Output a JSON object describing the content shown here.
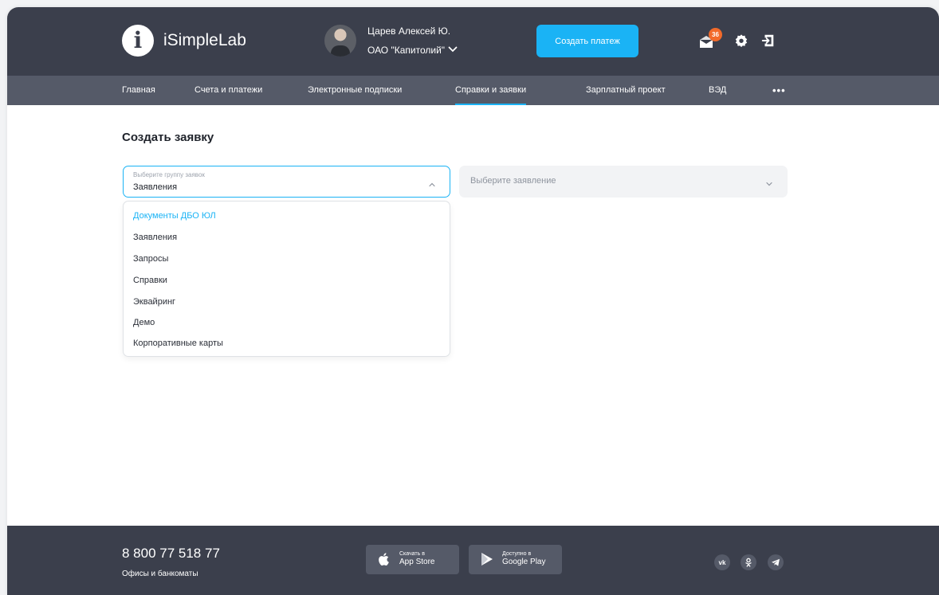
{
  "brand": {
    "initial": "i",
    "name": "iSimpleLab"
  },
  "user": {
    "name": "Царев Алексей Ю.",
    "org": "ОАО \"Капитолий\""
  },
  "header": {
    "create_payment": "Создать платеж",
    "notifications_count": "36"
  },
  "nav": {
    "items": [
      {
        "label": "Главная"
      },
      {
        "label": "Счета и платежи"
      },
      {
        "label": "Электронные подписки"
      },
      {
        "label": "Справки и заявки",
        "active": true
      },
      {
        "label": "Зарплатный проект"
      },
      {
        "label": "ВЭД"
      }
    ],
    "more": "•••"
  },
  "main": {
    "title": "Создать заявку",
    "group_select": {
      "caption": "Выберите группу заявок",
      "value": "Заявления"
    },
    "statement_select": {
      "placeholder": "Выберите заявление"
    },
    "dropdown_options": [
      "Документы ДБО ЮЛ",
      "Заявления",
      "Запросы",
      "Справки",
      "Эквайринг",
      "Демо",
      "Корпоративные карты"
    ]
  },
  "footer": {
    "phone": "8 800 77 518 77",
    "offices": "Офисы и банкоматы",
    "app_store": {
      "line1": "Скачать в",
      "line2": "App Store"
    },
    "google_play": {
      "line1": "Доступно в",
      "line2": "Google Play"
    },
    "social": [
      "vk-icon",
      "odnoklassniki-icon",
      "telegram-icon"
    ]
  },
  "colors": {
    "accent": "#1ab3f5",
    "header_bg": "#3b3f4c",
    "nav_bg": "#555a68",
    "badge": "#f26a2a"
  }
}
